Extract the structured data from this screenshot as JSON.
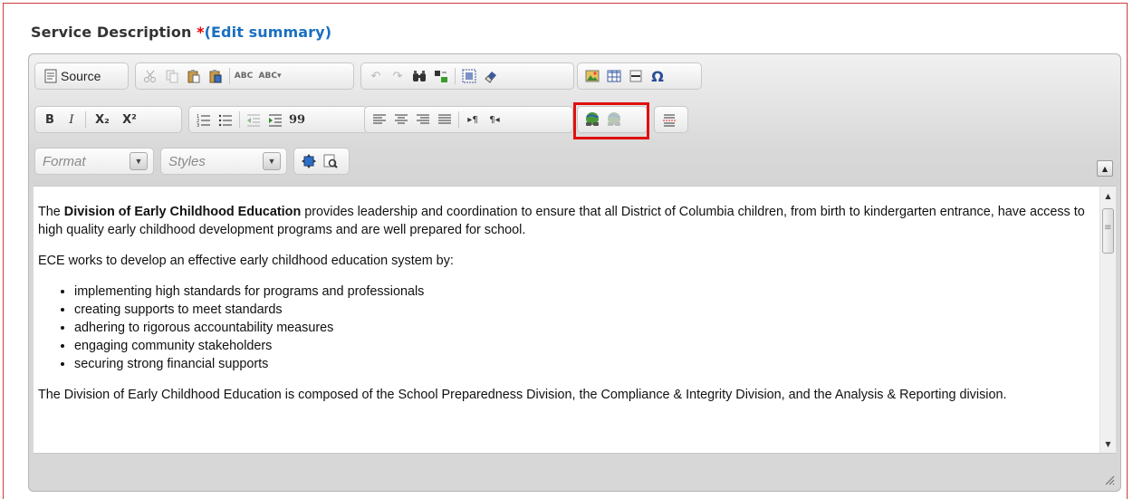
{
  "field": {
    "label": "Service Description ",
    "required_mark": "*",
    "open_paren": "(",
    "edit_link": "Edit summary",
    "close_paren": ")"
  },
  "toolbar": {
    "source_label": "Source",
    "format_placeholder": "Format",
    "styles_placeholder": "Styles"
  },
  "content": {
    "p1_prefix": "The ",
    "p1_bold": "Division of Early Childhood Education",
    "p1_rest": " provides leadership and coordination to ensure that all District of Columbia children, from birth to kindergarten entrance, have access to high quality early childhood development programs and are well prepared for school.",
    "p2": "ECE works to develop an effective early childhood education system by:",
    "bullets": [
      "implementing high standards for programs and professionals",
      "creating supports to meet standards",
      "adhering to rigorous accountability measures",
      "engaging community stakeholders",
      "securing strong financial supports"
    ],
    "p3": "The Division of Early Childhood Education is composed of the School Preparedness Division, the Compliance & Integrity Division, and the Analysis & Reporting division."
  },
  "icons": {
    "italic": "I",
    "bold": "B",
    "subscript": "X₂",
    "superscript": "X²",
    "quote": "99",
    "omega": "Ω",
    "spell": "ABC"
  },
  "colors": {
    "link": "#1a6fc0",
    "required": "#e00000",
    "highlight": "#e01010"
  }
}
